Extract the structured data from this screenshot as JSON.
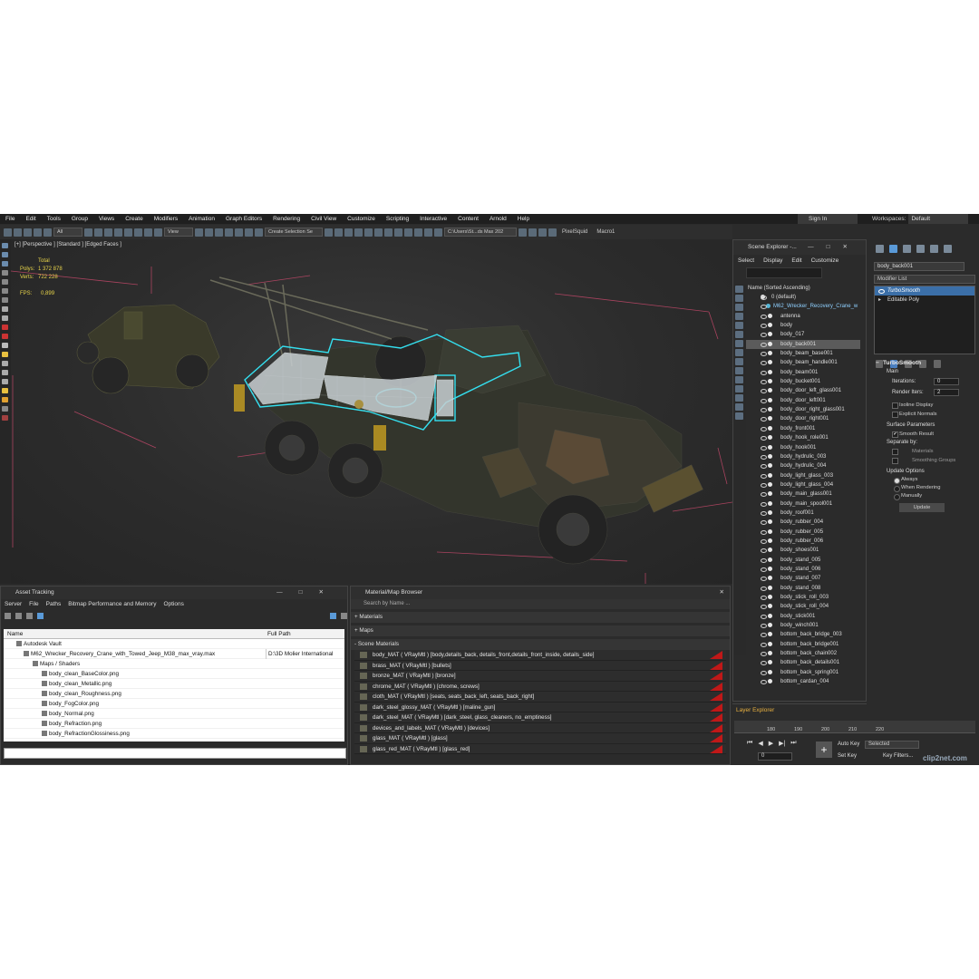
{
  "menu": [
    "File",
    "Edit",
    "Tools",
    "Group",
    "Views",
    "Create",
    "Modifiers",
    "Animation",
    "Graph Editors",
    "Rendering",
    "Civil View",
    "Customize",
    "Scripting",
    "Interactive",
    "Content",
    "Arnold",
    "Help"
  ],
  "signin": "Sign In",
  "workspaces": {
    "label": "Workspaces:",
    "value": "Default"
  },
  "toolbar": {
    "filter": "All",
    "refcoord": "View",
    "selection_set": "Create Selection Se",
    "path": "C:\\Users\\St...ds Max 202",
    "pixelsquid": "PixelSquid",
    "macro": "Macro1"
  },
  "viewport": {
    "label": "[+] [Perspective ] [Standard ] [Edged Faces ]",
    "stats_total": "Total",
    "polys_label": "Polys:",
    "polys": "1 372 878",
    "verts_label": "Verts:",
    "verts": "722 228",
    "fps_label": "FPS:",
    "fps": "0,899"
  },
  "scene_explorer": {
    "title": "Scene Explorer -...",
    "menu": [
      "Select",
      "Display",
      "Edit",
      "Customize"
    ],
    "column": "Name (Sorted Ascending)",
    "default_layer": "0 (default)",
    "root": "M62_Wrecker_Recovery_Crane_w",
    "items": [
      "antenna",
      "body",
      "body_017",
      "body_back001",
      "body_beam_base001",
      "body_beam_handle001",
      "body_beam001",
      "body_bucket001",
      "body_door_left_glass001",
      "body_door_left001",
      "body_door_right_glass001",
      "body_door_right001",
      "body_front001",
      "body_hook_role001",
      "body_hook001",
      "body_hydrulic_003",
      "body_hydrulic_004",
      "body_light_glass_003",
      "body_light_glass_004",
      "body_main_glass001",
      "body_main_spool001",
      "body_roof001",
      "body_rubber_004",
      "body_rubber_005",
      "body_rubber_006",
      "body_shoes001",
      "body_stand_005",
      "body_stand_006",
      "body_stand_007",
      "body_stand_008",
      "body_stick_roll_003",
      "body_stick_roll_004",
      "body_stick001",
      "body_winch001",
      "bottom_back_bridge_003",
      "bottom_back_bridge001",
      "bottom_back_chain002",
      "bottom_back_details001",
      "bottom_back_spring001",
      "bottom_cardan_004"
    ],
    "selected_index": 3,
    "layer_explorer": "Layer Explorer"
  },
  "command_panel": {
    "object_name": "body_back001",
    "modifier_list": "Modifier List",
    "stack": [
      "TurboSmooth",
      "Editable Poly"
    ],
    "rollout_title": "TurboSmooth",
    "main_group": "Main",
    "iterations_label": "Iterations:",
    "iterations": "0",
    "render_iters_label": "Render Iters:",
    "render_iters": "2",
    "isoline": "Isoline Display",
    "explicit": "Explicit Normals",
    "surface_group": "Surface Parameters",
    "smooth_result": "Smooth Result",
    "separate_by": "Separate by:",
    "materials": "Materials",
    "smoothing_groups": "Smoothing Groups",
    "update_group": "Update Options",
    "always": "Always",
    "when_rendering": "When Rendering",
    "manually": "Manually",
    "update_btn": "Update"
  },
  "asset_tracking": {
    "title": "Asset Tracking",
    "menu": [
      "Server",
      "File",
      "Paths",
      "Bitmap Performance and Memory",
      "Options"
    ],
    "col_name": "Name",
    "col_path": "Full Path",
    "rows": [
      {
        "indent": 14,
        "name": "Autodesk Vault",
        "path": ""
      },
      {
        "indent": 22,
        "name": "M62_Wrecker_Recovery_Crane_with_Towed_Jeep_M38_max_vray.max",
        "path": "D:\\3D Molier International"
      },
      {
        "indent": 32,
        "name": "Maps / Shaders",
        "path": ""
      },
      {
        "indent": 42,
        "name": "body_clean_BaseColor.png",
        "path": ""
      },
      {
        "indent": 42,
        "name": "body_clean_Metallic.png",
        "path": ""
      },
      {
        "indent": 42,
        "name": "body_clean_Roughness.png",
        "path": ""
      },
      {
        "indent": 42,
        "name": "body_FogColor.png",
        "path": ""
      },
      {
        "indent": 42,
        "name": "body_Normal.png",
        "path": ""
      },
      {
        "indent": 42,
        "name": "body_Refraction.png",
        "path": ""
      },
      {
        "indent": 42,
        "name": "body_RefractionGlossiness.png",
        "path": ""
      }
    ]
  },
  "material_browser": {
    "title": "Material/Map Browser",
    "search": "Search by Name ...",
    "sec_materials": "+ Materials",
    "sec_maps": "+ Maps",
    "sec_scene": "- Scene Materials",
    "rows": [
      "body_MAT ( VRayMtl ) [body,details_back, details_front,details_front_inside, details_side]",
      "brass_MAT ( VRayMtl ) [bullets]",
      "bronze_MAT ( VRayMtl ) [bronze]",
      "chrome_MAT ( VRayMtl ) [chrome, screws]",
      "cloth_MAT ( VRayMtl ) [seats, seats_back_left, seats_back_right]",
      "dark_steel_glossy_MAT ( VRayMtl ) [maline_gun]",
      "dark_steel_MAT ( VRayMtl ) [dark_steel, glass_cleaners, no_emptiness]",
      "devices_and_labels_MAT ( VRayMtl ) [devices]",
      "glass_MAT ( VRayMtl ) [glass]",
      "glass_red_MAT ( VRayMtl ) [glass_red]"
    ]
  },
  "timeline": {
    "ticks": [
      "180",
      "190",
      "200",
      "210",
      "220"
    ],
    "frame": "0",
    "auto_key": "Auto Key",
    "selected": "Selected",
    "set_key": "Set Key",
    "key_filters": "Key Filters..."
  },
  "watermark": "clip2net.com"
}
